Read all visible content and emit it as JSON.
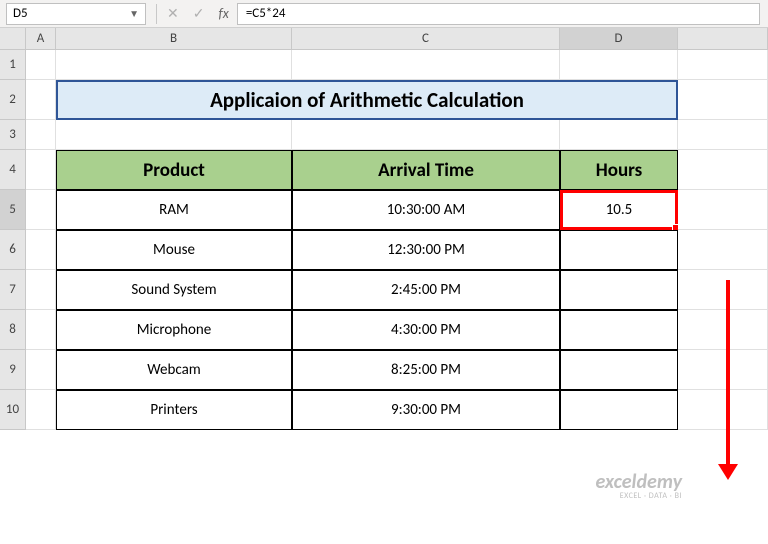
{
  "formula_bar": {
    "cell_ref": "D5",
    "formula": "=C5*24"
  },
  "columns": [
    "A",
    "B",
    "C",
    "D"
  ],
  "rows": [
    "1",
    "2",
    "3",
    "4",
    "5",
    "6",
    "7",
    "8",
    "9",
    "10"
  ],
  "title": "Applicaion of Arithmetic Calculation",
  "headers": {
    "product": "Product",
    "arrival": "Arrival Time",
    "hours": "Hours"
  },
  "chart_data": {
    "type": "table",
    "columns": [
      "Product",
      "Arrival Time",
      "Hours"
    ],
    "rows": [
      {
        "product": "RAM",
        "arrival": "10:30:00 AM",
        "hours": "10.5"
      },
      {
        "product": "Mouse",
        "arrival": "12:30:00 PM",
        "hours": ""
      },
      {
        "product": "Sound System",
        "arrival": "2:45:00 PM",
        "hours": ""
      },
      {
        "product": "Microphone",
        "arrival": "4:30:00 PM",
        "hours": ""
      },
      {
        "product": "Webcam",
        "arrival": "8:25:00 PM",
        "hours": ""
      },
      {
        "product": "Printers",
        "arrival": "9:30:00 PM",
        "hours": ""
      }
    ]
  },
  "watermark": {
    "line1": "exceldemy",
    "line2": "EXCEL · DATA · BI"
  }
}
